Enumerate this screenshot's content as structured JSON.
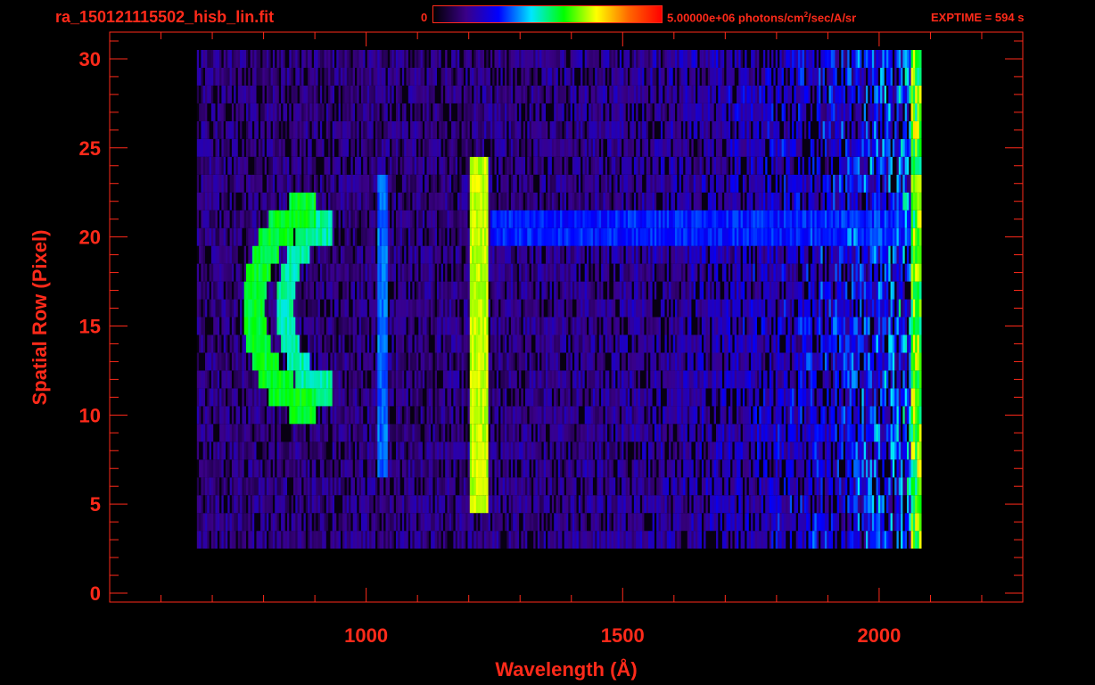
{
  "header": {
    "filename": "ra_150121115502_hisb_lin.fit",
    "colorbar_min": "0",
    "colorbar_max_prefix": "5.00000e+06 photons/cm",
    "colorbar_max_sup": "2",
    "colorbar_max_suffix": "/sec/A/sr",
    "exptime_label": "EXPTIME = ",
    "exptime_value": "594",
    "exptime_unit": "s",
    "colormap": [
      "#000000",
      "#3a0088",
      "#0000ff",
      "#00e6ff",
      "#00ff00",
      "#ffff00",
      "#ff6600",
      "#ff0000"
    ]
  },
  "chart_data": {
    "type": "heatmap",
    "xlabel": "Wavelength (Å)",
    "ylabel": "Spatial Row (Pixel)",
    "xlim": [
      500,
      2280
    ],
    "ylim": [
      -0.5,
      31.5
    ],
    "xticks": [
      1000,
      1500,
      2000
    ],
    "yticks": [
      0,
      5,
      10,
      15,
      20,
      25,
      30
    ],
    "x_minor_step": 100,
    "y_minor_step": 1,
    "color_range": [
      0,
      5000000
    ],
    "data_extent": {
      "x": [
        670,
        2080
      ],
      "rows": [
        3,
        30
      ]
    },
    "features": [
      {
        "name": "Ly-alpha",
        "x": [
          1200,
          1235
        ],
        "rows": [
          5,
          24
        ],
        "level": 0.68
      },
      {
        "name": "emission",
        "x": [
          1020,
          1040
        ],
        "rows": [
          7,
          23
        ],
        "level": 0.35
      },
      {
        "name": "arc-outer",
        "x_center": 900,
        "x_radius": 120,
        "row_center": 16,
        "row_radius": 5.5,
        "level": 0.55
      },
      {
        "name": "arc-inner",
        "x_center": 930,
        "x_radius": 90,
        "row_center": 16,
        "row_radius": 4.5,
        "level": 0.48
      },
      {
        "name": "continuum",
        "x": [
          1240,
          2080
        ],
        "rows": [
          20,
          21
        ],
        "level": 0.3
      }
    ],
    "color": "#ff2a1a"
  }
}
